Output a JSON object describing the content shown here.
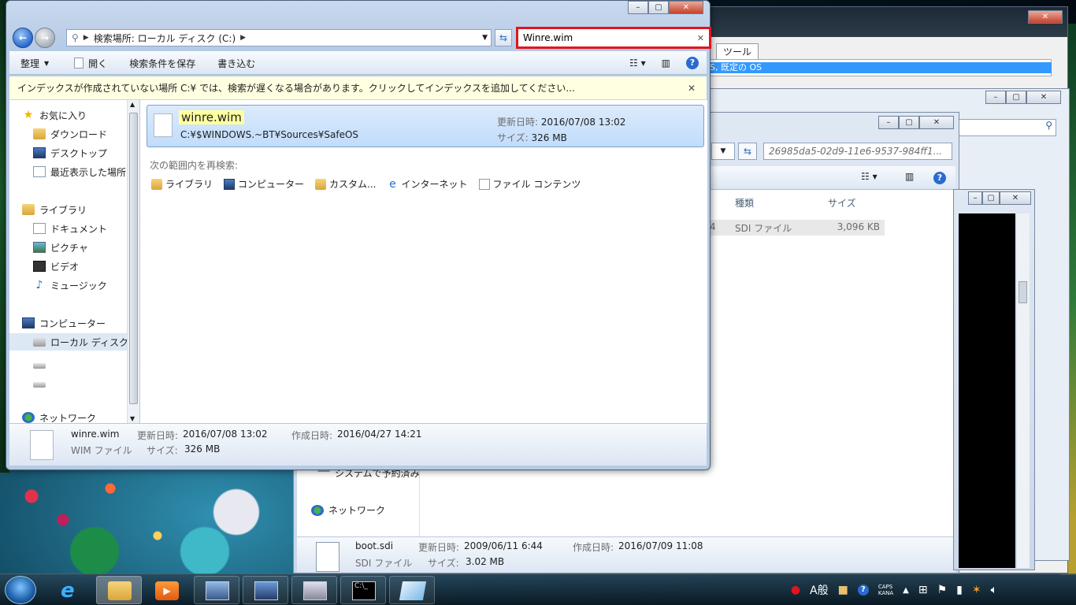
{
  "window": {
    "breadcrumb": "検索場所: ローカル ディスク (C:)",
    "search_value": "Winre.wim",
    "toolbar": {
      "organize": "整理",
      "open": "開く",
      "save_search": "検索条件を保存",
      "burn": "書き込む"
    },
    "infobar": "インデックスが作成されていない場所 C:¥ では、検索が遅くなる場合があります。クリックしてインデックスを追加してください..."
  },
  "nav": {
    "favorites": "お気に入り",
    "downloads": "ダウンロード",
    "desktop": "デスクトップ",
    "recent": "最近表示した場所",
    "libraries": "ライブラリ",
    "documents": "ドキュメント",
    "pictures": "ピクチャ",
    "videos": "ビデオ",
    "music": "ミュージック",
    "computer": "コンピューター",
    "local_disk": "ローカル ディスク",
    "network": "ネットワーク"
  },
  "result": {
    "name": "winre.wim",
    "path": "C:¥$WINDOWS.~BT¥Sources¥SafeOS",
    "modified_label": "更新日時:",
    "modified": "2016/07/08 13:02",
    "size_label": "サイズ:",
    "size": "326 MB"
  },
  "search_again": {
    "title": "次の範囲内を再検索:",
    "items": [
      "ライブラリ",
      "コンピューター",
      "カスタム...",
      "インターネット",
      "ファイル コンテンツ"
    ]
  },
  "details": {
    "name": "winre.wim",
    "type": "WIM ファイル",
    "modified_label": "更新日時:",
    "modified": "2016/07/08 13:02",
    "created_label": "作成日時:",
    "created": "2016/04/27 14:21",
    "size_label": "サイズ:",
    "size": "326 MB"
  },
  "back1": {
    "tab": "ツール",
    "selected_text": "S, 既定の OS",
    "search_path": "26985da5-02d9-11e6-9537-984ff1...",
    "col_type": "種類",
    "col_size": "サイズ",
    "row_tail": "4",
    "row_type": "SDI ファイル",
    "row_size": "3,096 KB",
    "sys_partial": "システムで予約済み",
    "network": "ネットワーク",
    "details_name": "boot.sdi",
    "details_type": "SDI ファイル",
    "details_modified_label": "更新日時:",
    "details_modified": "2009/06/11 6:44",
    "details_created_label": "作成日時:",
    "details_created": "2016/07/09 11:08",
    "details_size_label": "サイズ:",
    "details_size": "3.02 MB"
  },
  "tray": {
    "ime_a": "A",
    "ime_mode": "般",
    "caps": "CAPS",
    "kana": "KANA"
  }
}
